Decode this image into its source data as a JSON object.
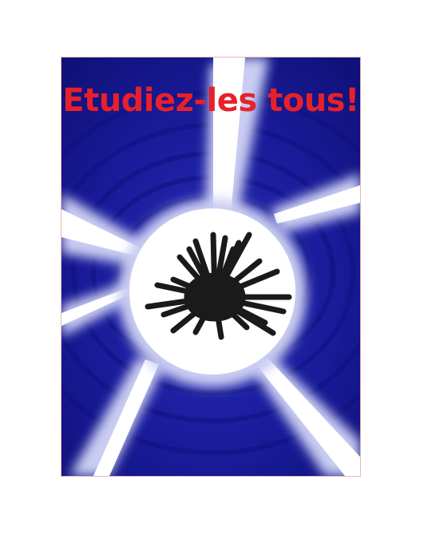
{
  "poster": {
    "title": "Etudiez-les tous!",
    "title_color": "#e8202a",
    "background_color": "#1a1c9c",
    "ray_color": "#ffffff",
    "center_disc_color": "#ffffff",
    "burst_color": "#1a1a1a",
    "burst_icon": "starburst-icon"
  }
}
